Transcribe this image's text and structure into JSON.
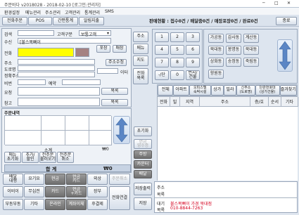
{
  "window": {
    "title": "주문바다 v2018028 - 2018-02-10 [로그인:관리자]"
  },
  "menu": [
    "환경설정",
    "메뉴관리",
    "주소관리",
    "고객관리",
    "통계관리",
    "SMS"
  ],
  "toolbar": [
    "전화주문",
    "POS",
    "간편통계",
    "알림지출"
  ],
  "status": {
    "text": "판매현황 : 접수0건 / 배달중0건 / 매장포장0건 / 완료0건",
    "close": "종료"
  },
  "customer": {
    "search_label": "검색",
    "grade_label": "고객구분",
    "grade_value": "보통고객",
    "receive_label": "수신",
    "receive_value": "[불스목뼈이",
    "phone_label": "전화",
    "pack_btn": "포장",
    "store_btn": "매장",
    "addr_label": "주소",
    "road_label": "도로명",
    "jibun_label": "정확주소",
    "addr_edit_btn": "주소수정",
    "distance_label": "이터",
    "memo_label": "비번",
    "reserve_label": "예약",
    "request_label": "요청",
    "note_label": "참고",
    "req_btn": "목록",
    "note_btn": "목록"
  },
  "order": {
    "title": "주문내역",
    "subtotal_label": "소계",
    "subtotal_value": "₩0",
    "total_label": "합 계",
    "total_value": "₩0"
  },
  "order_buttons": [
    "메뉴\n초기화",
    "추가/\n할인",
    "전주문\n불러오기",
    "전주문\n취소"
  ],
  "side_buttons": [
    "주소",
    "메뉴",
    "지도",
    "전화\n목록"
  ],
  "numpad": [
    "1",
    "2",
    "3",
    "4",
    "5",
    "6",
    "7",
    "8",
    "9",
    "-/단",
    "0",
    "번지/\n건물"
  ],
  "center_buttons": {
    "reset": "초기화",
    "trash": "휴지통",
    "receive": "현금\n영수증",
    "print": "주방",
    "cancel": "카운터",
    "delivery": "배달",
    "save": "저장출력",
    "store": "저장"
  },
  "pay_buttons": [
    "배달\n대행",
    "요기요",
    "현금",
    "현금\n카드",
    "외상",
    "이비이",
    "무십전",
    "카드",
    "현금\n+카드",
    "장부",
    "부동부동",
    "기타",
    "온라인",
    "계좌이체",
    "후결제"
  ],
  "history_btn": "주문취소",
  "connect_btn": "전화연결",
  "regions": [
    "가공동",
    "감사동",
    "계산동",
    "북대동",
    "봉명동",
    "북대동",
    "상화동",
    "송정동",
    "죽림동",
    "향원동"
  ],
  "building_tabs": [
    "전체",
    "아파트",
    "오피스텔\n숙박시설",
    "상가",
    "빌라",
    "신주소\n(도로명)",
    "단관번호대\n(상가건물)",
    "즐겨찾기"
  ],
  "building_cols": [
    "전화",
    "빌",
    "지역",
    "주소",
    "층/호",
    "순서",
    "기타"
  ],
  "bottom_right": {
    "addr_label": "주소",
    "memo_label": "목록",
    "memo_value": "불스목뼈이 가경 북대점",
    "phone_value": "010-8844-7263",
    "contact_label": "대기\n목록"
  },
  "colors": {
    "phone_bg": "#ffff00",
    "accent": "#d4001f",
    "header_bg": "#c7d3e3"
  }
}
